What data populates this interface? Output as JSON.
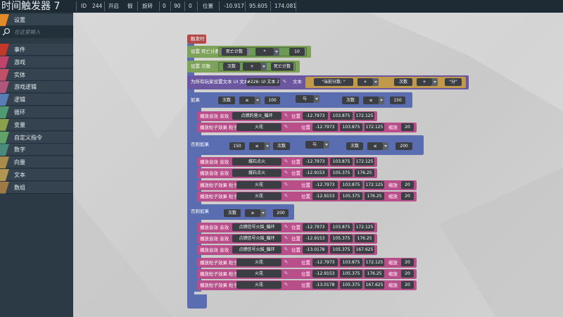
{
  "topbar": {
    "title": "时间触发器 7",
    "id_label": "ID",
    "id_value": "244",
    "enabled_label": "开启",
    "enabled_value": "假",
    "rotation_label": "旋转",
    "rot_x": "0",
    "rot_y": "90",
    "rot_z": "0",
    "position_label": "位置",
    "pos_x": "-10.917",
    "pos_y": "95.605",
    "pos_z": "174.081"
  },
  "sidebar": {
    "settings": "设置",
    "search_placeholder": "在这里输入",
    "categories": [
      {
        "label": "事件",
        "color": "#c0392b"
      },
      {
        "label": "游戏",
        "color": "#c0446a"
      },
      {
        "label": "实体",
        "color": "#c0506a"
      },
      {
        "label": "游戏逻辑",
        "color": "#b0567d"
      },
      {
        "label": "逻辑",
        "color": "#5a7db8"
      },
      {
        "label": "循环",
        "color": "#4f9a72"
      },
      {
        "label": "变量",
        "color": "#8aa04a"
      },
      {
        "label": "自定义指令",
        "color": "#5fa36a"
      },
      {
        "label": "数字",
        "color": "#4a8a7a"
      },
      {
        "label": "向量",
        "color": "#a88a4a"
      },
      {
        "label": "文本",
        "color": "#b09650"
      },
      {
        "label": "数组",
        "color": "#a07a46"
      }
    ]
  },
  "blocks": {
    "hat": "触发时",
    "set_death_label": "设置 死亡计数",
    "death_var": "死亡计数",
    "op_mult": "*",
    "val_10": "10",
    "set_count_label": "设置 次数",
    "count_var": "次数",
    "op_plus": "+",
    "death_var2": "死亡计数",
    "ui_text_label": "为所有玩家设置文本 UI 文本",
    "ui_id": "#226: UI 文本 2",
    "text_label": "文本",
    "score_text": "\"当前分数: \"",
    "op_plus2": "+",
    "count_var2": "次数",
    "op_plus3": "+",
    "fen_text": "\"分\"",
    "if_label": "如果",
    "count_a": "次数",
    "ge": "≥",
    "v100": "100",
    "and1": "与",
    "count_b": "次数",
    "le": "≤",
    "v150": "150",
    "play_sound": "播放音效 音效",
    "sound1": "点燃的营火_循环",
    "pos": "位置",
    "p1x": "-12.7973",
    "p1y": "103.875",
    "p1z": "172.125",
    "play_particle": "播放粒子效果 粒子",
    "fire": "火花",
    "scale": "缩放",
    "s20": "20",
    "elseif_label": "否则如果",
    "v150b": "150",
    "le2": "≤",
    "count_c": "次数",
    "and2": "与",
    "count_d": "次数",
    "le3": "≤",
    "v200": "200",
    "sound2": "燧石点火",
    "p2x": "-12.9153",
    "p2y": "105.375",
    "p2z": "176.25",
    "count_e": "次数",
    "ge2": "≥",
    "v200b": "200",
    "sound3": "点燃信号火焰_循环",
    "p3x": "-13.0178",
    "p3y": "105.375",
    "p3z": "167.625"
  }
}
